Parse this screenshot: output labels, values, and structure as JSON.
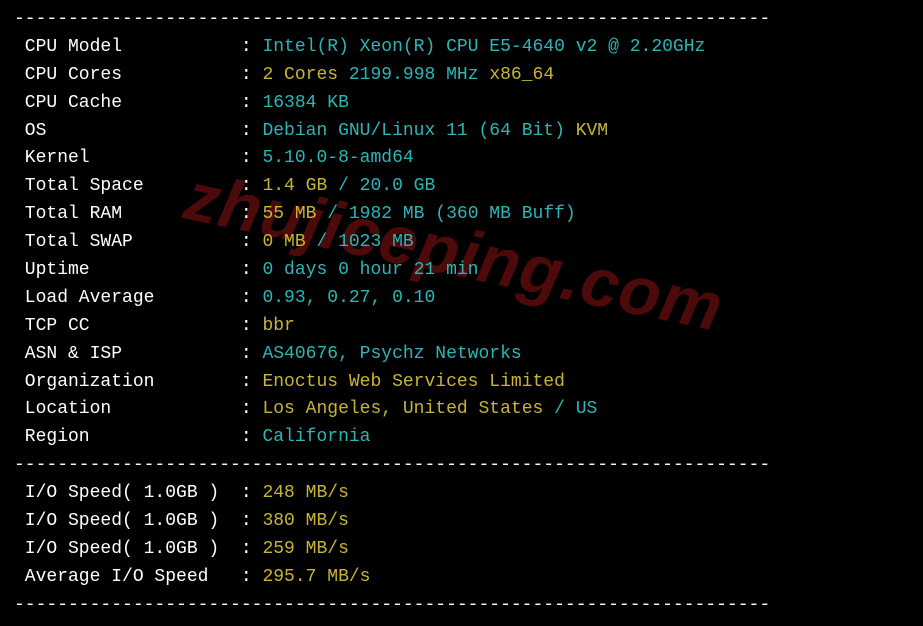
{
  "divider": "----------------------------------------------------------------------",
  "watermark": "zhujiceping.com",
  "rows": [
    {
      "label": "CPU Model",
      "parts": [
        {
          "cls": "cyan",
          "text": "Intel(R) Xeon(R) CPU E5-4640 v2 @ 2.20GHz"
        }
      ]
    },
    {
      "label": "CPU Cores",
      "parts": [
        {
          "cls": "yellow",
          "text": "2 Cores"
        },
        {
          "cls": "cyan",
          "text": " 2199.998 MHz"
        },
        {
          "cls": "yellow",
          "text": " x86_64"
        }
      ]
    },
    {
      "label": "CPU Cache",
      "parts": [
        {
          "cls": "cyan",
          "text": "16384 KB"
        }
      ]
    },
    {
      "label": "OS",
      "parts": [
        {
          "cls": "cyan",
          "text": "Debian GNU/Linux 11 (64 Bit)"
        },
        {
          "cls": "yellow",
          "text": " KVM"
        }
      ]
    },
    {
      "label": "Kernel",
      "parts": [
        {
          "cls": "cyan",
          "text": "5.10.0-8-amd64"
        }
      ]
    },
    {
      "label": "Total Space",
      "parts": [
        {
          "cls": "yellow",
          "text": "1.4 GB"
        },
        {
          "cls": "cyan",
          "text": " / 20.0 GB"
        }
      ]
    },
    {
      "label": "Total RAM",
      "parts": [
        {
          "cls": "yellow",
          "text": "55 MB"
        },
        {
          "cls": "cyan",
          "text": " / 1982 MB"
        },
        {
          "cls": "cyan",
          "text": " (360 MB Buff)"
        }
      ]
    },
    {
      "label": "Total SWAP",
      "parts": [
        {
          "cls": "yellow",
          "text": "0 MB"
        },
        {
          "cls": "cyan",
          "text": " / 1023 MB"
        }
      ]
    },
    {
      "label": "Uptime",
      "parts": [
        {
          "cls": "cyan",
          "text": "0 days 0 hour 21 min"
        }
      ]
    },
    {
      "label": "Load Average",
      "parts": [
        {
          "cls": "cyan",
          "text": "0.93, 0.27, 0.10"
        }
      ]
    },
    {
      "label": "TCP CC",
      "parts": [
        {
          "cls": "yellow",
          "text": "bbr"
        }
      ]
    },
    {
      "label": "ASN & ISP",
      "parts": [
        {
          "cls": "cyan",
          "text": "AS40676, Psychz Networks"
        }
      ]
    },
    {
      "label": "Organization",
      "parts": [
        {
          "cls": "yellow",
          "text": "Enoctus Web Services Limited"
        }
      ]
    },
    {
      "label": "Location",
      "parts": [
        {
          "cls": "yellow",
          "text": "Los Angeles, United States"
        },
        {
          "cls": "cyan",
          "text": " / US"
        }
      ]
    },
    {
      "label": "Region",
      "parts": [
        {
          "cls": "cyan",
          "text": "California"
        }
      ]
    }
  ],
  "io_rows": [
    {
      "label": "I/O Speed( 1.0GB )",
      "parts": [
        {
          "cls": "yellow",
          "text": "248 MB/s"
        }
      ]
    },
    {
      "label": "I/O Speed( 1.0GB )",
      "parts": [
        {
          "cls": "yellow",
          "text": "380 MB/s"
        }
      ]
    },
    {
      "label": "I/O Speed( 1.0GB )",
      "parts": [
        {
          "cls": "yellow",
          "text": "259 MB/s"
        }
      ]
    },
    {
      "label": "Average I/O Speed",
      "parts": [
        {
          "cls": "yellow",
          "text": "295.7 MB/s"
        }
      ]
    }
  ]
}
